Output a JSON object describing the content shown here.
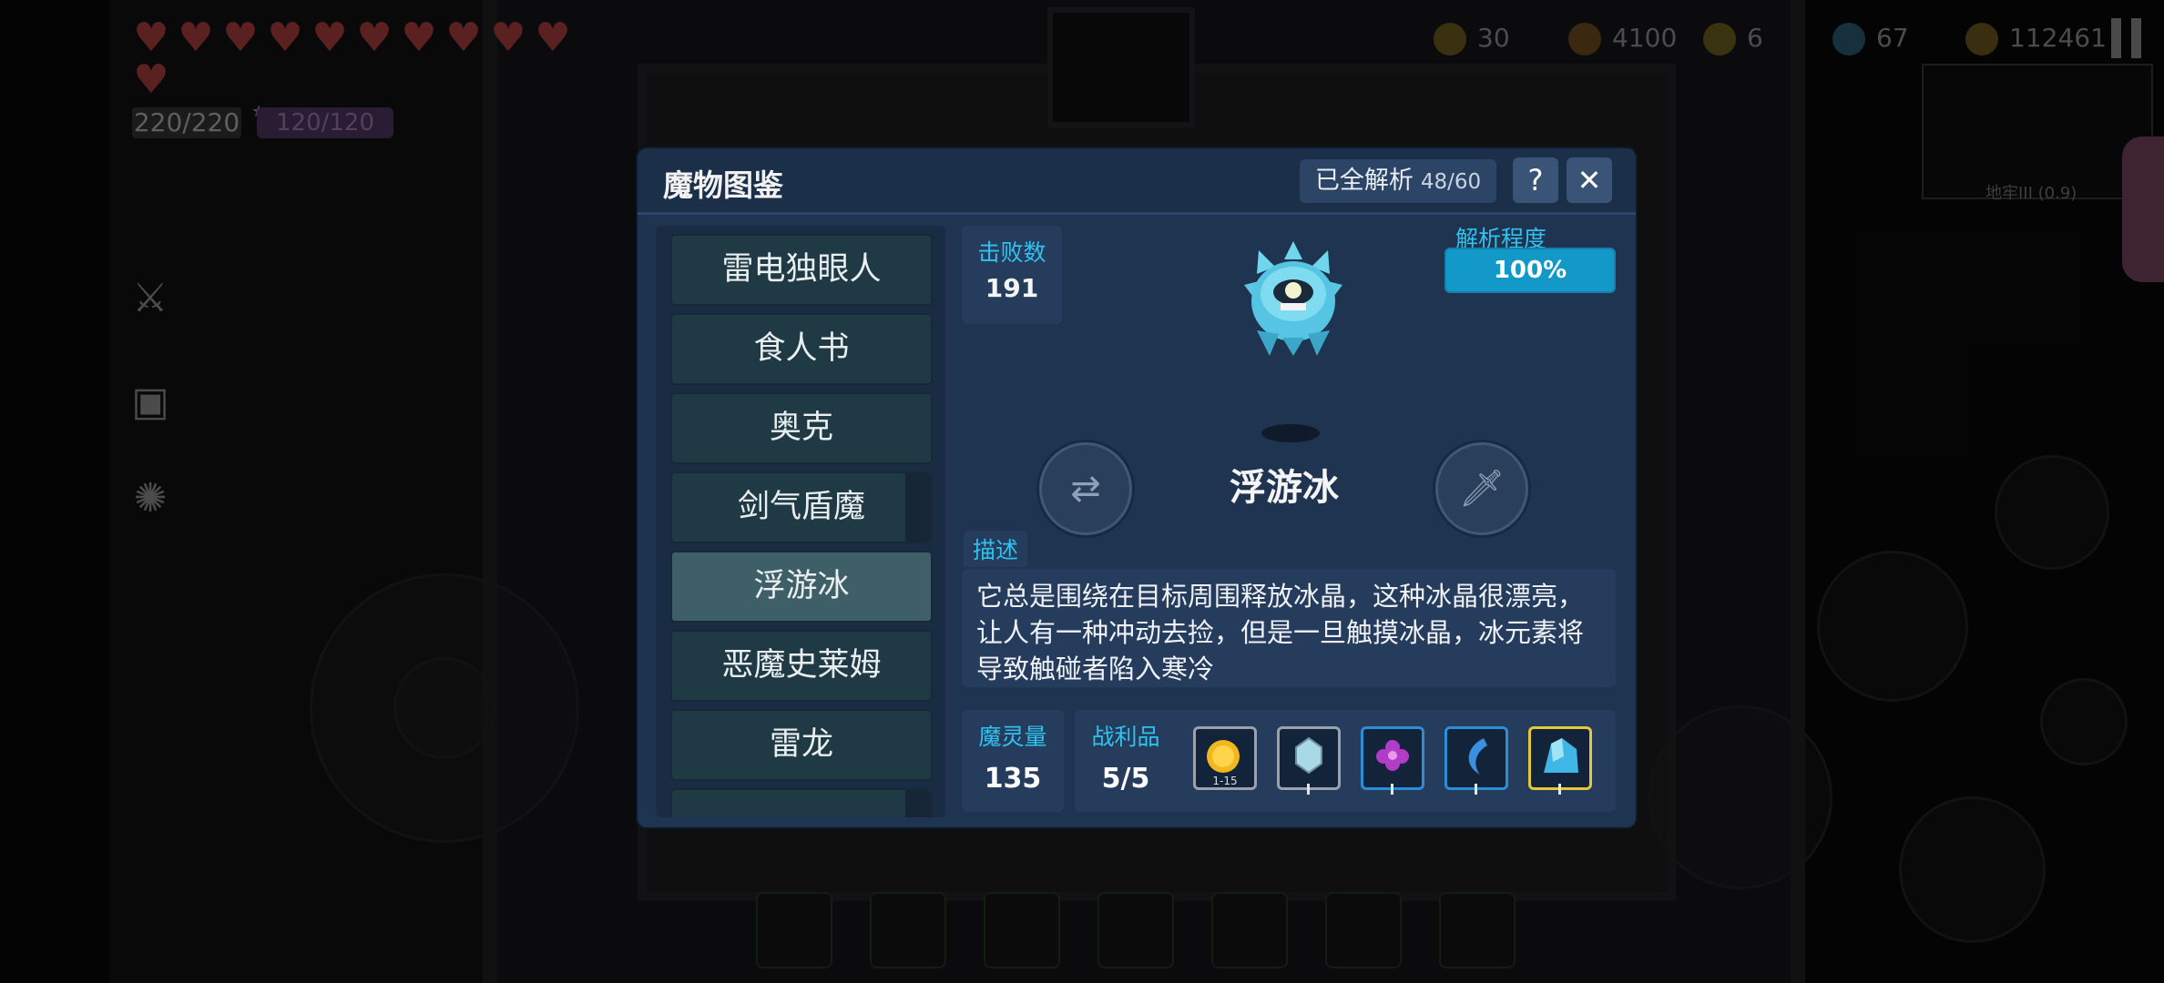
{
  "hud": {
    "hearts_count": 11,
    "hp": "220/220",
    "mp": "120/120",
    "resources": [
      {
        "icon": "crown-icon",
        "value": "30",
        "color": "#d0a020"
      },
      {
        "icon": "diamond-ore-icon",
        "value": "4100",
        "color": "#c07a20"
      },
      {
        "icon": "key-icon",
        "value": "6",
        "color": "#d4b030"
      },
      {
        "icon": "gem-icon",
        "value": "67",
        "color": "#3aa6d8"
      },
      {
        "icon": "coin-icon",
        "value": "112461",
        "color": "#d4a020"
      }
    ],
    "minimap_label": "地牢III (0.9)"
  },
  "modal": {
    "title": "魔物图鉴",
    "parsed_label": "已全解析",
    "parsed_count": "48/60",
    "help_label": "?",
    "close_label": "✕"
  },
  "monster_list": [
    {
      "name": "雷电独眼人",
      "active": false
    },
    {
      "name": "食人书",
      "active": false
    },
    {
      "name": "奥克",
      "active": false
    },
    {
      "name": "剑气盾魔",
      "active": false
    },
    {
      "name": "浮游冰",
      "active": true
    },
    {
      "name": "恶魔史莱姆",
      "active": false
    },
    {
      "name": "雷龙",
      "active": false
    }
  ],
  "detail": {
    "kills_label": "击败数",
    "kills_value": "191",
    "analysis_label": "解析程度",
    "analysis_value": "100%",
    "analysis_fraction": 1.0,
    "monster_name": "浮游冰",
    "desc_label": "描述",
    "description": "它总是围绕在目标周围释放冰晶，这种冰晶很漂亮，让人有一种冲动去捡，但是一旦触摸冰晶，冰元素将导致触碰者陷入寒冷",
    "soul_label": "魔灵量",
    "soul_value": "135",
    "loot_label": "战利品",
    "loot_value": "5/5",
    "loot": [
      {
        "icon": "gold-coin-icon",
        "count": "1-15",
        "border": "#9aa2ad"
      },
      {
        "icon": "ice-crystal-icon",
        "count": "",
        "border": "#9aa2ad"
      },
      {
        "icon": "purple-flower-icon",
        "count": "",
        "border": "#2c8fd6"
      },
      {
        "icon": "ice-horn-icon",
        "count": "",
        "border": "#2c8fd6"
      },
      {
        "icon": "ice-shard-icon",
        "count": "",
        "border": "#e3c93a"
      }
    ]
  }
}
